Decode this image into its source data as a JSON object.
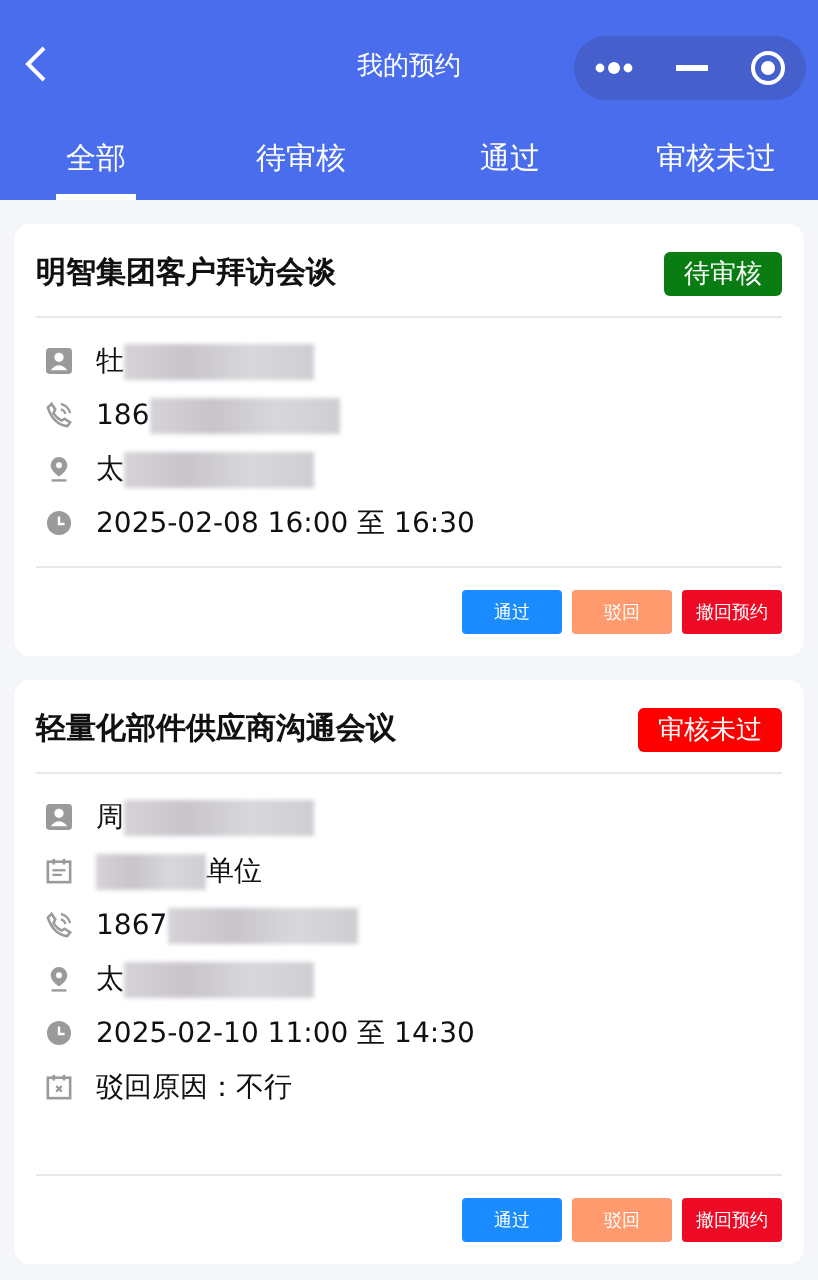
{
  "header": {
    "title": "我的预约"
  },
  "tabs": [
    {
      "label": "全部",
      "selected": true
    },
    {
      "label": "待审核",
      "selected": false
    },
    {
      "label": "通过",
      "selected": false
    },
    {
      "label": "审核未过",
      "selected": false
    }
  ],
  "appointments": [
    {
      "title": "明智集团客户拜访会谈",
      "status": {
        "label": "待审核",
        "kind": "pending"
      },
      "rows": [
        {
          "kind": "person",
          "text": "牡"
        },
        {
          "kind": "phone",
          "text": "186"
        },
        {
          "kind": "location",
          "text": "太"
        },
        {
          "kind": "time",
          "text": "2025-02-08 16:00 至 16:30"
        }
      ],
      "buttons": [
        {
          "label": "通过",
          "kind": "approve"
        },
        {
          "label": "驳回",
          "kind": "reject"
        },
        {
          "label": "撤回预约",
          "kind": "revoke"
        }
      ]
    },
    {
      "title": "轻量化部件供应商沟通会议",
      "status": {
        "label": "审核未过",
        "kind": "rejected"
      },
      "rows": [
        {
          "kind": "person",
          "text": "周"
        },
        {
          "kind": "company",
          "text": "单位"
        },
        {
          "kind": "phone",
          "text": "1867"
        },
        {
          "kind": "location",
          "text": "太"
        },
        {
          "kind": "time",
          "text": "2025-02-10 11:00 至 14:30"
        },
        {
          "kind": "reason",
          "text": "驳回原因：不行"
        }
      ],
      "buttons": [
        {
          "label": "通过",
          "kind": "approve"
        },
        {
          "label": "驳回",
          "kind": "reject"
        },
        {
          "label": "撤回预约",
          "kind": "revoke"
        }
      ]
    }
  ]
}
